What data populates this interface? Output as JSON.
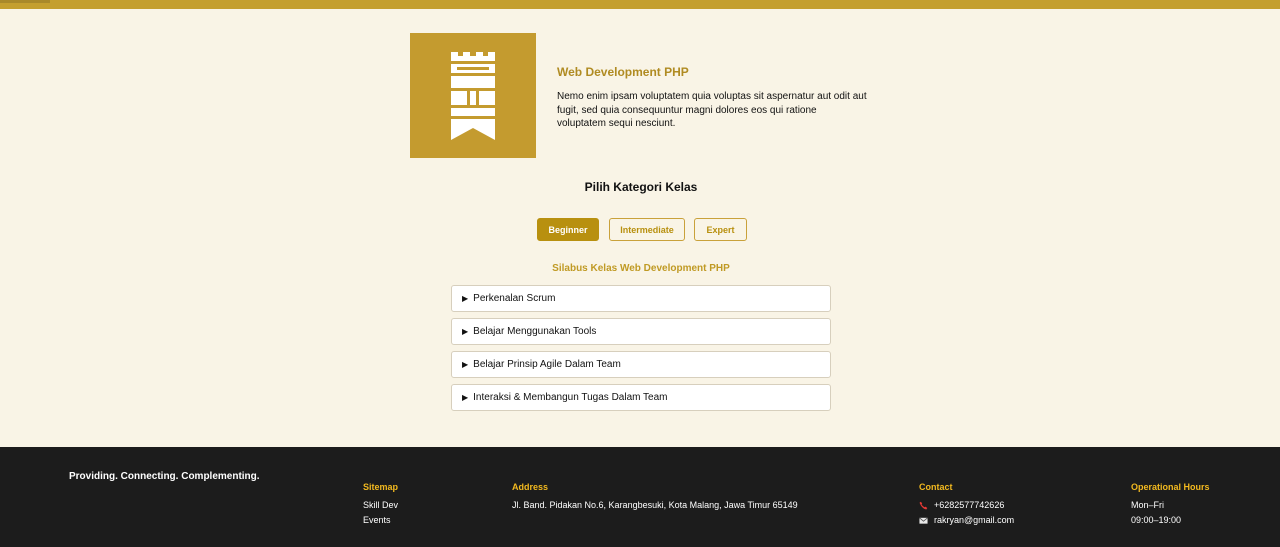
{
  "colors": {
    "accent": "#c49f2f",
    "button_active": "#b8900f",
    "footer_bg": "#1c1c1c",
    "footer_heading": "#f2b91f",
    "page_bg": "#f9f4e6"
  },
  "course": {
    "logo_icon": "fortress-logo-icon",
    "title": "Web Development PHP",
    "description": "Nemo enim ipsam voluptatem quia voluptas sit aspernatur aut odit aut fugit, sed quia consequuntur magni dolores eos qui ratione voluptatem sequi nesciunt."
  },
  "categories": {
    "heading": "Pilih Kategori Kelas",
    "tabs": [
      {
        "label": "Beginner",
        "active": true
      },
      {
        "label": "Intermediate",
        "active": false
      },
      {
        "label": "Expert",
        "active": false
      }
    ]
  },
  "syllabus": {
    "heading": "Silabus Kelas Web Development PHP",
    "items": [
      {
        "label": "Perkenalan Scrum"
      },
      {
        "label": "Belajar Menggunakan Tools"
      },
      {
        "label": "Belajar Prinsip Agile Dalam Team"
      },
      {
        "label": "Interaksi & Membangun Tugas Dalam Team"
      }
    ]
  },
  "footer": {
    "tagline": "Providing. Connecting. Complementing.",
    "sitemap": {
      "heading": "Sitemap",
      "links": [
        "Skill Dev",
        "Events"
      ]
    },
    "address": {
      "heading": "Address",
      "text": "Jl. Band. Pidakan No.6, Karangbesuki, Kota Malang, Jawa Timur 65149"
    },
    "contact": {
      "heading": "Contact",
      "phone": "+6282577742626",
      "email": "rakryan@gmail.com",
      "phone_icon": "phone-icon",
      "email_icon": "email-icon"
    },
    "hours": {
      "heading": "Operational Hours",
      "days": "Mon–Fri",
      "time": "09:00–19:00"
    }
  }
}
